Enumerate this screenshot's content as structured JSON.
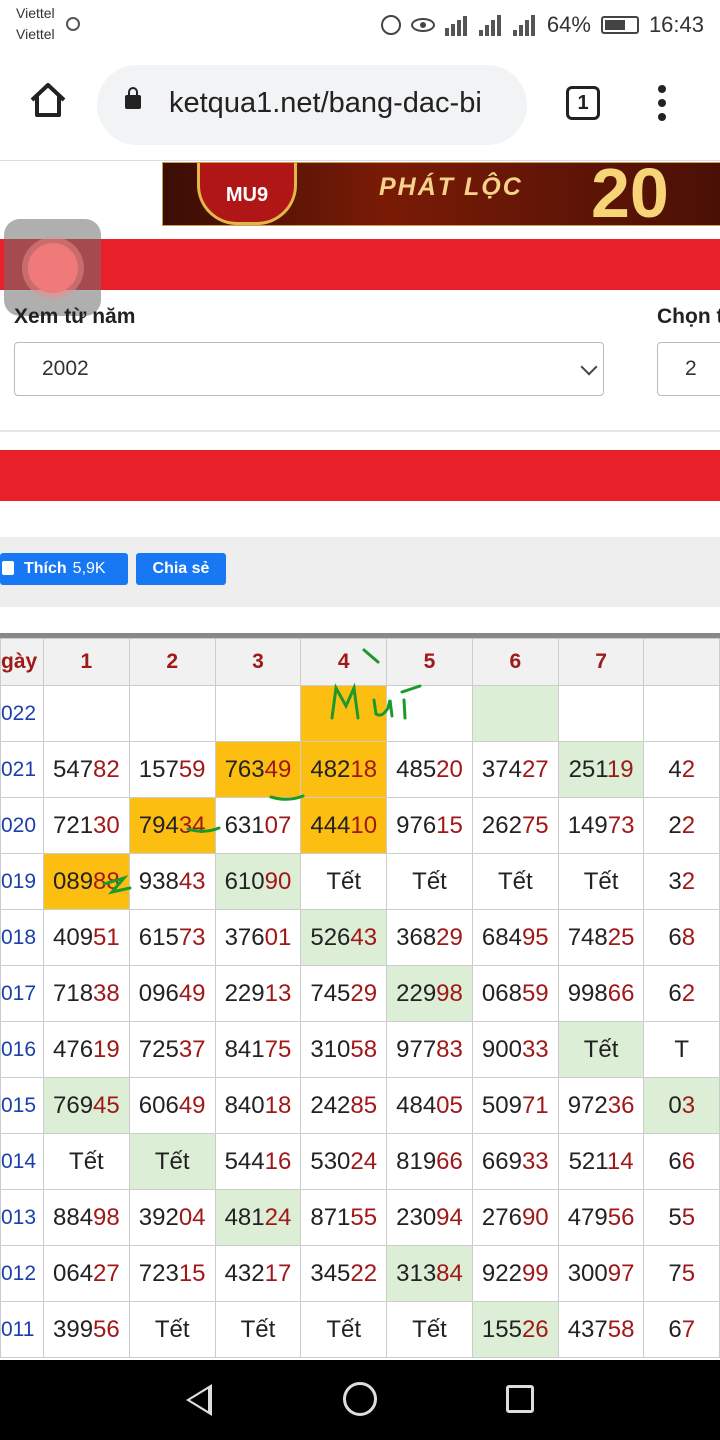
{
  "status": {
    "carrier1": "Viettel",
    "carrier2": "Viettel",
    "battery": "64%",
    "time": "16:43"
  },
  "browser": {
    "url": "ketqua1.net/bang-dac-bi",
    "tab_count": "1"
  },
  "banner": {
    "logo": "MU9",
    "text": "PHÁT LỘC",
    "number": "20"
  },
  "form": {
    "from_year_label": "Xem từ năm",
    "from_year_value": "2002",
    "choose_label": "Chọn t",
    "choose_value": "2"
  },
  "social": {
    "like_label": "Thích",
    "like_count": "5,9K",
    "share_label": "Chia sẻ"
  },
  "table": {
    "header": [
      "gày",
      "1",
      "2",
      "3",
      "4",
      "5",
      "6",
      "7",
      ""
    ],
    "rows": [
      {
        "year": "022",
        "cells": [
          {
            "a": "",
            "b": ""
          },
          {
            "a": "",
            "b": ""
          },
          {
            "a": "",
            "b": ""
          },
          {
            "a": "",
            "b": "",
            "h": "orange"
          },
          {
            "a": "",
            "b": ""
          },
          {
            "a": "",
            "b": "",
            "h": "green"
          },
          {
            "a": "",
            "b": ""
          },
          {
            "a": "",
            "b": ""
          }
        ]
      },
      {
        "year": "021",
        "cells": [
          {
            "a": "547",
            "b": "82"
          },
          {
            "a": "157",
            "b": "59"
          },
          {
            "a": "763",
            "b": "49",
            "h": "orange"
          },
          {
            "a": "482",
            "b": "18",
            "h": "orange"
          },
          {
            "a": "485",
            "b": "20"
          },
          {
            "a": "374",
            "b": "27"
          },
          {
            "a": "251",
            "b": "19",
            "h": "green"
          },
          {
            "a": "4",
            "b": "2"
          }
        ]
      },
      {
        "year": "020",
        "cells": [
          {
            "a": "721",
            "b": "30"
          },
          {
            "a": "794",
            "b": "34",
            "h": "orange"
          },
          {
            "a": "631",
            "b": "07"
          },
          {
            "a": "444",
            "b": "10",
            "h": "orange"
          },
          {
            "a": "976",
            "b": "15"
          },
          {
            "a": "262",
            "b": "75"
          },
          {
            "a": "149",
            "b": "73"
          },
          {
            "a": "2",
            "b": "2"
          }
        ]
      },
      {
        "year": "019",
        "cells": [
          {
            "a": "089",
            "b": "88",
            "h": "orange"
          },
          {
            "a": "938",
            "b": "43"
          },
          {
            "a": "610",
            "b": "90",
            "h": "green"
          },
          {
            "a": "Tết",
            "b": ""
          },
          {
            "a": "Tết",
            "b": ""
          },
          {
            "a": "Tết",
            "b": ""
          },
          {
            "a": "Tết",
            "b": ""
          },
          {
            "a": "3",
            "b": "2"
          }
        ]
      },
      {
        "year": "018",
        "cells": [
          {
            "a": "409",
            "b": "51"
          },
          {
            "a": "615",
            "b": "73"
          },
          {
            "a": "376",
            "b": "01"
          },
          {
            "a": "526",
            "b": "43",
            "h": "green"
          },
          {
            "a": "368",
            "b": "29"
          },
          {
            "a": "684",
            "b": "95"
          },
          {
            "a": "748",
            "b": "25"
          },
          {
            "a": "6",
            "b": "8"
          }
        ]
      },
      {
        "year": "017",
        "cells": [
          {
            "a": "718",
            "b": "38"
          },
          {
            "a": "096",
            "b": "49"
          },
          {
            "a": "229",
            "b": "13"
          },
          {
            "a": "745",
            "b": "29"
          },
          {
            "a": "229",
            "b": "98",
            "h": "green"
          },
          {
            "a": "068",
            "b": "59"
          },
          {
            "a": "998",
            "b": "66"
          },
          {
            "a": "6",
            "b": "2"
          }
        ]
      },
      {
        "year": "016",
        "cells": [
          {
            "a": "476",
            "b": "19"
          },
          {
            "a": "725",
            "b": "37"
          },
          {
            "a": "841",
            "b": "75"
          },
          {
            "a": "310",
            "b": "58"
          },
          {
            "a": "977",
            "b": "83"
          },
          {
            "a": "900",
            "b": "33"
          },
          {
            "a": "Tết",
            "b": "",
            "h": "green"
          },
          {
            "a": "T",
            "b": ""
          }
        ]
      },
      {
        "year": "015",
        "cells": [
          {
            "a": "769",
            "b": "45",
            "h": "green"
          },
          {
            "a": "606",
            "b": "49"
          },
          {
            "a": "840",
            "b": "18"
          },
          {
            "a": "242",
            "b": "85"
          },
          {
            "a": "484",
            "b": "05"
          },
          {
            "a": "509",
            "b": "71"
          },
          {
            "a": "972",
            "b": "36"
          },
          {
            "a": "0",
            "b": "3",
            "h": "green"
          }
        ]
      },
      {
        "year": "014",
        "cells": [
          {
            "a": "Tết",
            "b": ""
          },
          {
            "a": "Tết",
            "b": "",
            "h": "green"
          },
          {
            "a": "544",
            "b": "16"
          },
          {
            "a": "530",
            "b": "24"
          },
          {
            "a": "819",
            "b": "66"
          },
          {
            "a": "669",
            "b": "33"
          },
          {
            "a": "521",
            "b": "14"
          },
          {
            "a": "6",
            "b": "6"
          }
        ]
      },
      {
        "year": "013",
        "cells": [
          {
            "a": "884",
            "b": "98"
          },
          {
            "a": "392",
            "b": "04"
          },
          {
            "a": "481",
            "b": "24",
            "h": "green"
          },
          {
            "a": "871",
            "b": "55"
          },
          {
            "a": "230",
            "b": "94"
          },
          {
            "a": "276",
            "b": "90"
          },
          {
            "a": "479",
            "b": "56"
          },
          {
            "a": "5",
            "b": "5"
          }
        ]
      },
      {
        "year": "012",
        "cells": [
          {
            "a": "064",
            "b": "27"
          },
          {
            "a": "723",
            "b": "15"
          },
          {
            "a": "432",
            "b": "17"
          },
          {
            "a": "345",
            "b": "22"
          },
          {
            "a": "313",
            "b": "84",
            "h": "green"
          },
          {
            "a": "922",
            "b": "99"
          },
          {
            "a": "300",
            "b": "97"
          },
          {
            "a": "7",
            "b": "5"
          }
        ]
      },
      {
        "year": "011",
        "cells": [
          {
            "a": "399",
            "b": "56"
          },
          {
            "a": "Tết",
            "b": ""
          },
          {
            "a": "Tết",
            "b": ""
          },
          {
            "a": "Tết",
            "b": ""
          },
          {
            "a": "Tết",
            "b": ""
          },
          {
            "a": "155",
            "b": "26",
            "h": "green"
          },
          {
            "a": "437",
            "b": "58"
          },
          {
            "a": "6",
            "b": "7"
          }
        ]
      }
    ]
  },
  "annotation": {
    "handwritten": "Mui"
  }
}
